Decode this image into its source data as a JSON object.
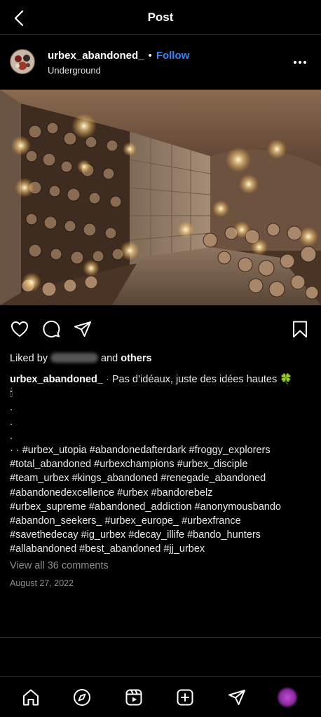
{
  "header": {
    "title": "Post",
    "back_icon": "back-arrow-icon"
  },
  "post": {
    "username": "urbex_abandoned_",
    "follow_label": "Follow",
    "location": "Underground",
    "more_icon": "more-options-icon"
  },
  "actions": {
    "like_icon": "heart-icon",
    "comment_icon": "comment-icon",
    "share_icon": "send-icon",
    "save_icon": "bookmark-icon"
  },
  "likes": {
    "prefix": "Liked by",
    "connector": "and",
    "others": "others"
  },
  "caption": {
    "username": "urbex_abandoned_",
    "text": "Pas d’idéaux, juste des idées hautes 🍀",
    "candle": "🕯",
    "dots": [
      ".",
      ".",
      "."
    ],
    "lead": "· ·",
    "hashtag_lines": [
      "#urbex_utopia #abandonedafterdark #froggy_explorers",
      "#total_abandoned #urbexchampions #urbex_disciple",
      "#team_urbex #kings_abandoned #renegade_abandoned",
      "#abandonedexcellence #urbex #bandorebelz",
      "#urbex_supreme #abandoned_addiction #anonymousbando",
      "#abandon_seekers_ #urbex_europe_ #urbexfrance",
      "#savethedecay #ig_urbex #decay_illife #bando_hunters",
      "#allabandoned #best_abandoned #jj_urbex"
    ]
  },
  "view_comments": "View all 36 comments",
  "date": "August 27, 2022",
  "tabbar": {
    "items": [
      "home-icon",
      "explore-icon",
      "reels-icon",
      "create-icon",
      "direct-icon",
      "profile-avatar"
    ]
  },
  "colors": {
    "background": "#000000",
    "follow": "#3b82f6",
    "muted": "#8e8e8e"
  }
}
